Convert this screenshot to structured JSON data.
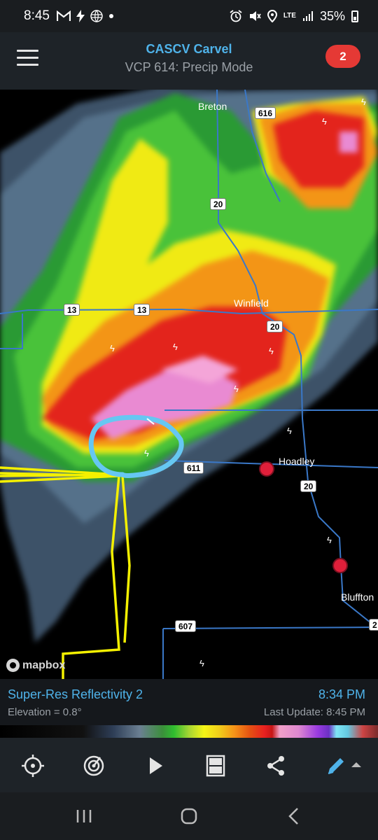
{
  "status_bar": {
    "time": "8:45",
    "left_icons": [
      "gmail-icon",
      "bolt-icon",
      "globe-icon",
      "dot-icon"
    ],
    "right_icons": [
      "alarm-icon",
      "mute-icon",
      "location-icon",
      "lte-icon",
      "signal-icon"
    ],
    "network": "LTE",
    "battery": "35%"
  },
  "header": {
    "title": "CASCV Carvel",
    "subtitle": "VCP 614: Precip Mode",
    "alert_count": "2",
    "menu_icon": "hamburger-icon"
  },
  "map": {
    "places": [
      "Breton",
      "Winfield",
      "Hoadley",
      "Bluffton"
    ],
    "highway_shields": [
      "616",
      "20",
      "13",
      "13",
      "20",
      "611",
      "20",
      "607",
      "2"
    ],
    "attribution": "mapbox",
    "colors": {
      "highway": "#3a78c8",
      "storm_cell_track": "#66c7f2",
      "warning_polygon": "#f4f000",
      "marker": "#e01f3a"
    }
  },
  "info": {
    "product": "Super-Res Reflectivity 2",
    "elevation": "Elevation = 0.8°",
    "scan_time": "8:34 PM",
    "last_update": "Last Update: 8:45 PM"
  },
  "toolbar": {
    "tools": [
      "crosshair-icon",
      "radar-icon",
      "play-icon",
      "layout-icon",
      "share-icon",
      "pencil-icon"
    ],
    "accent": "#4fb3ea"
  },
  "nav_bar": {
    "buttons": [
      "recents-icon",
      "home-icon",
      "back-icon"
    ]
  }
}
